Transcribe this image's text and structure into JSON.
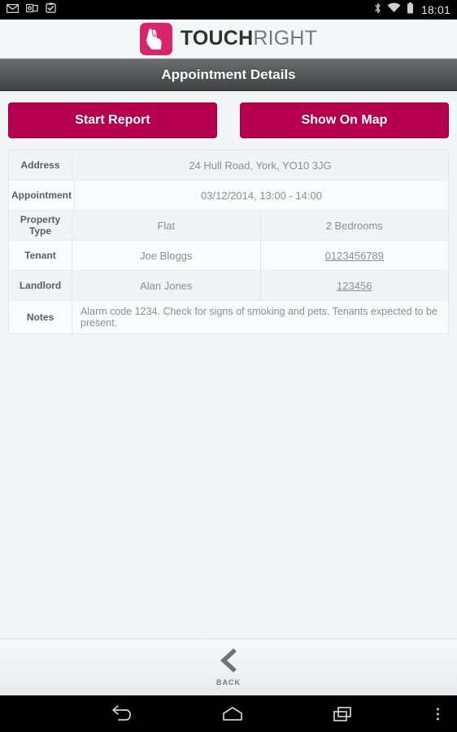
{
  "statusbar": {
    "time": "18:01",
    "left_icons": [
      {
        "name": "email-icon",
        "label": "Email"
      },
      {
        "name": "outlook-mail-icon",
        "label": "Outlook"
      },
      {
        "name": "clipboard-check-icon",
        "label": "Tasks"
      }
    ],
    "right_icons": [
      {
        "name": "bluetooth-icon",
        "label": "Bluetooth"
      },
      {
        "name": "wifi-icon",
        "label": "Wi-Fi"
      },
      {
        "name": "battery-icon",
        "label": "Battery"
      }
    ]
  },
  "brand": {
    "logo_icon": "touchright-hand-logo-icon",
    "name_bold": "TOUCH",
    "name_light": "RIGHT",
    "accent_color": "#d6256c"
  },
  "titlebar": {
    "title": "Appointment Details"
  },
  "actions": {
    "start_report_label": "Start Report",
    "show_on_map_label": "Show On Map",
    "button_color": "#b6004f"
  },
  "details": {
    "rows": [
      {
        "label": "Address",
        "value": "24 Hull Road, York, YO10 3JG",
        "split": false,
        "link": false
      },
      {
        "label": "Appointment",
        "value": "03/12/2014, 13:00 - 14:00",
        "split": false,
        "link": false
      },
      {
        "label": "Property Type",
        "value": "Flat",
        "value2": "2 Bedrooms",
        "split": true,
        "link": false
      },
      {
        "label": "Tenant",
        "value": "Joe Bloggs",
        "value2": "0123456789",
        "split": true,
        "link": true
      },
      {
        "label": "Landlord",
        "value": "Alan Jones",
        "value2": "123456",
        "split": true,
        "link": true
      },
      {
        "label": "Notes",
        "value": "Alarm code 1234. Check for signs of smoking and pets. Tenants expected to be present.",
        "split": false,
        "link": false
      }
    ]
  },
  "footer": {
    "back_icon": "chevron-left-icon",
    "back_label": "BACK"
  },
  "navbar": {
    "buttons": [
      {
        "name": "android-back-icon",
        "label": "Back"
      },
      {
        "name": "android-home-icon",
        "label": "Home"
      },
      {
        "name": "android-recents-icon",
        "label": "Recents"
      }
    ],
    "overflow": {
      "name": "overflow-menu-icon",
      "label": "More options"
    }
  }
}
